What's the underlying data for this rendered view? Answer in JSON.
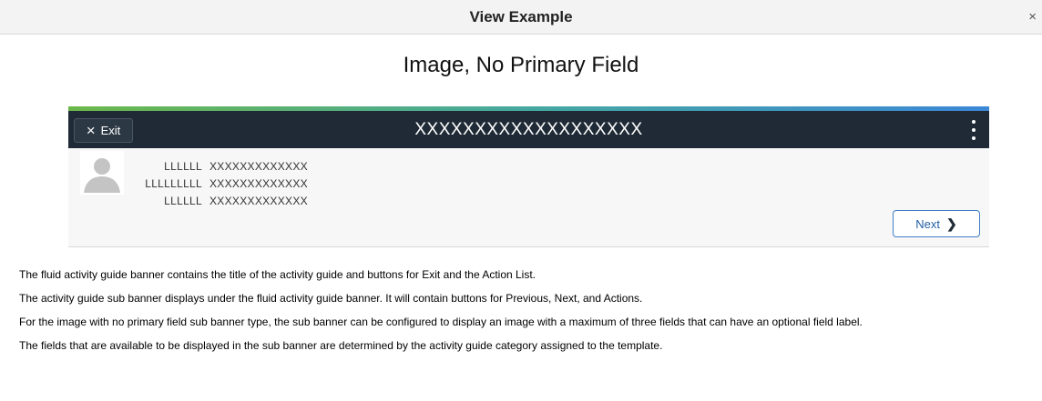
{
  "dialog": {
    "title": "View Example",
    "close_symbol": "×"
  },
  "page": {
    "heading": "Image, No Primary Field"
  },
  "banner": {
    "exit_icon": "×",
    "exit_label": "Exit",
    "title": "XXXXXXXXXXXXXXXXXXX",
    "actions_icon": "kebab-menu-icon"
  },
  "sub_banner": {
    "fields": [
      {
        "label": "LLLLLL",
        "value": "XXXXXXXXXXXXX"
      },
      {
        "label": "LLLLLLLLL",
        "value": "XXXXXXXXXXXXX"
      },
      {
        "label": "LLLLLL",
        "value": "XXXXXXXXXXXXX"
      }
    ],
    "next_label": "Next",
    "next_icon": "❯"
  },
  "description": [
    "The fluid activity guide banner contains the title of the activity guide and buttons for Exit and the Action List.",
    "The activity guide sub banner displays under the fluid activity guide banner.  It will contain buttons for Previous, Next, and Actions.",
    "For the image with no primary field sub banner type, the sub banner can be configured to display an image with a maximum of three fields that can have an optional field label.",
    "The fields that are available to be displayed in the sub banner are determined by the activity guide category assigned to the template."
  ],
  "colors": {
    "banner_bg": "#1f2a36",
    "accent_start": "#6bb84a",
    "accent_end": "#3c87d6",
    "next_border": "#3f7dc6"
  }
}
